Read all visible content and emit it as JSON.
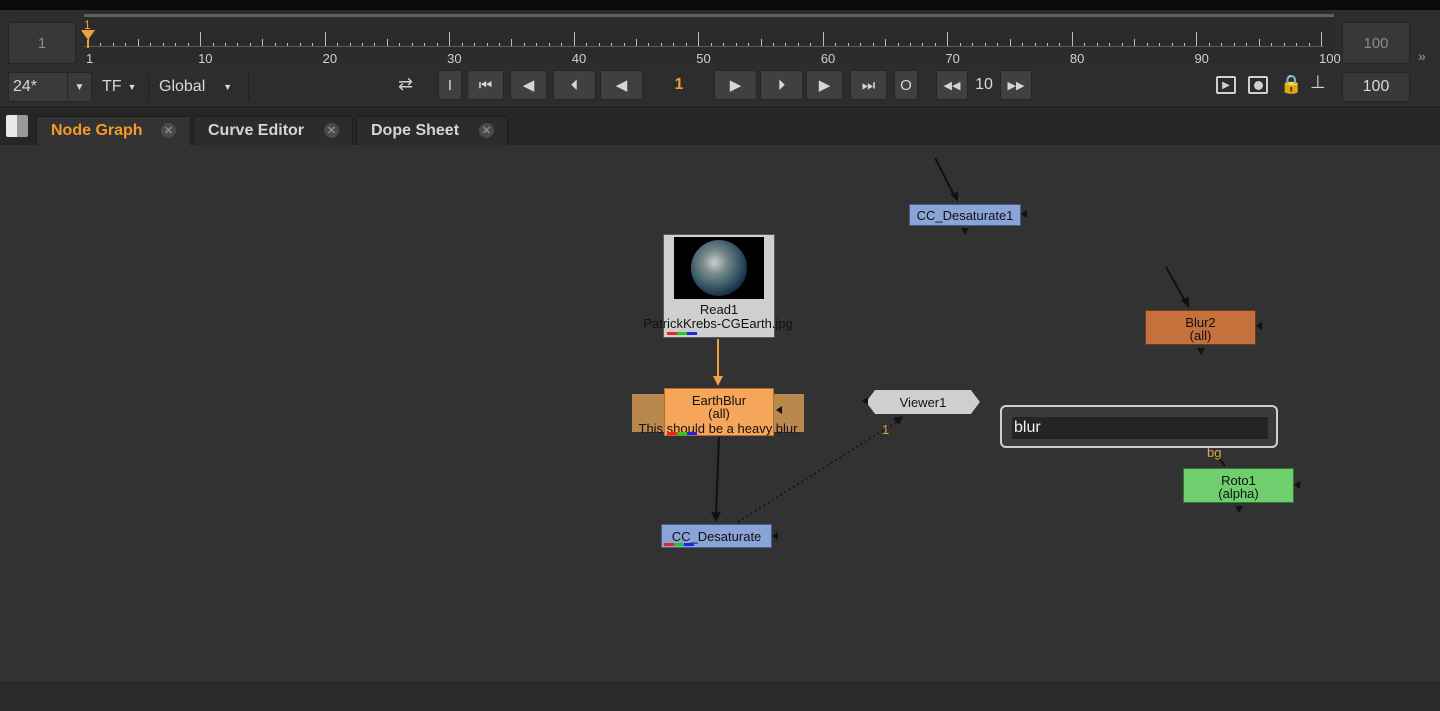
{
  "timeline": {
    "start_frame": "1",
    "end_frame_top": "100",
    "end_frame_bottom": "100",
    "current_frame": "1",
    "playhead_label": "1",
    "ticks": [
      "1",
      "10",
      "20",
      "30",
      "40",
      "50",
      "60",
      "70",
      "80",
      "90",
      "100"
    ]
  },
  "controls": {
    "fps": "24*",
    "tf": "TF",
    "global": "Global",
    "in_label": "I",
    "out_label": "O",
    "skip_increment": "10"
  },
  "tabs": [
    {
      "label": "Node Graph",
      "active": true
    },
    {
      "label": "Curve Editor",
      "active": false
    },
    {
      "label": "Dope Sheet",
      "active": false
    }
  ],
  "nodes": {
    "read1": {
      "name": "Read1",
      "file": "PatrickKrebs-CGEarth.jpg"
    },
    "earthblur": {
      "name": "EarthBlur",
      "channels": "(all)",
      "note": "This should be a heavy blur"
    },
    "cc_desaturate": {
      "name": "CC_Desaturate"
    },
    "cc_desaturate1": {
      "name": "CC_Desaturate1"
    },
    "viewer1": {
      "name": "Viewer1",
      "input_label": "1"
    },
    "blur2": {
      "name": "Blur2",
      "channels": "(all)"
    },
    "roto1": {
      "name": "Roto1",
      "channels": "(alpha)",
      "input_label": "bg"
    }
  },
  "search": {
    "value": "blur"
  },
  "colors": {
    "accent": "#f49a2b",
    "blur_node": "#c5713b",
    "earthblur_node": "#f5a65a",
    "desaturate_node": "#8aa4d8",
    "roto_node": "#6fcf6f"
  }
}
